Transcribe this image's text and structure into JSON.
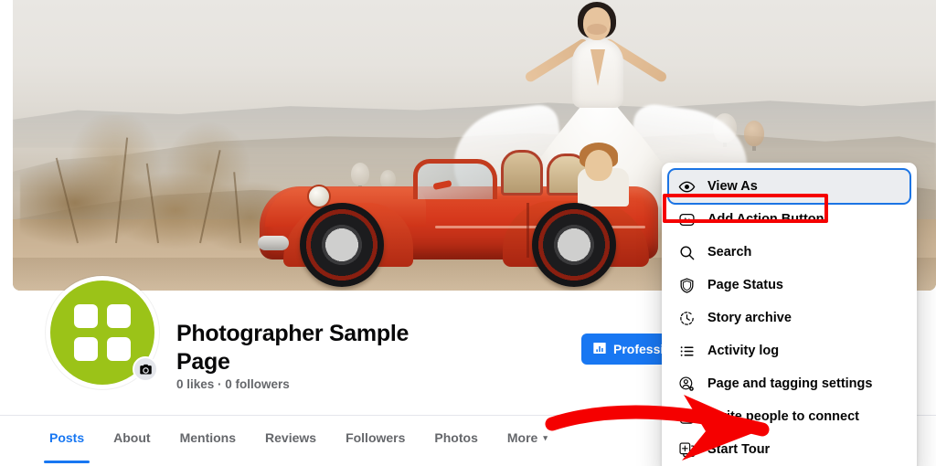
{
  "cover": {
    "alt": "bride-in-white-dress-and-red-vintage-convertible-in-cappadocia"
  },
  "profile": {
    "page_title": "Photographer Sample Page",
    "stats": "0 likes · 0 followers",
    "avatar_color": "#9bc318",
    "avatar_icon": "grid-squares-logo",
    "camera_badge_icon": "camera-icon"
  },
  "actions": {
    "professional_dashboard_label": "Professional dashboard",
    "professional_dashboard_icon": "bar-chart-icon",
    "professional_dashboard_color": "#1877f2",
    "more_options_icon": "ellipsis-icon"
  },
  "tabs": {
    "active": "Posts",
    "items": [
      {
        "label": "Posts",
        "active": true
      },
      {
        "label": "About",
        "active": false
      },
      {
        "label": "Mentions",
        "active": false
      },
      {
        "label": "Reviews",
        "active": false
      },
      {
        "label": "Followers",
        "active": false
      },
      {
        "label": "Photos",
        "active": false
      },
      {
        "label": "More",
        "active": false,
        "caret": "▾"
      }
    ]
  },
  "menu": {
    "items": [
      {
        "label": "View As",
        "icon": "eye-icon",
        "focused": true
      },
      {
        "label": "Add Action Button",
        "icon": "action-button-icon",
        "focused": false
      },
      {
        "label": "Search",
        "icon": "search-icon",
        "focused": false
      },
      {
        "label": "Page Status",
        "icon": "shield-icon",
        "focused": false
      },
      {
        "label": "Story archive",
        "icon": "clock-archive-icon",
        "focused": false
      },
      {
        "label": "Activity log",
        "icon": "list-icon",
        "focused": false
      },
      {
        "label": "Page and tagging settings",
        "icon": "person-gear-icon",
        "focused": false
      },
      {
        "label": "Invite people to connect",
        "icon": "add-person-box-icon",
        "focused": false
      },
      {
        "label": "Start Tour",
        "icon": "tour-cards-icon",
        "focused": false
      }
    ]
  },
  "annotations": {
    "highlight_color": "#f50000",
    "highlight_target": "Add Action Button",
    "arrow_color": "#f50000",
    "arrow_points_to": "more-options-ellipsis-button"
  }
}
